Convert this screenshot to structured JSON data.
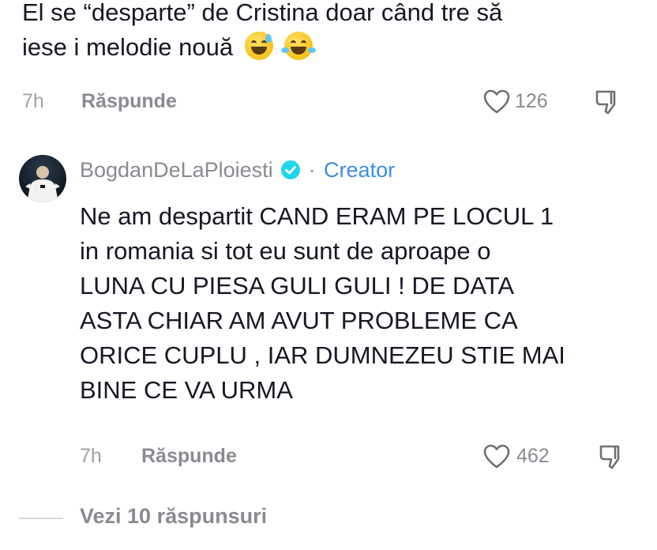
{
  "top_comment": {
    "text_line1": "El se “desparte” de Cristina doar când tre să",
    "text_line2": "iese i melodie nouă",
    "emojis": [
      "sweat-smile-emoji",
      "joy-emoji"
    ],
    "time": "7h",
    "reply_label": "Răspunde",
    "likes": "126"
  },
  "reply_comment": {
    "author": "BogdanDeLaPloiesti",
    "separator": "·",
    "role_label": "Creator",
    "lines": [
      "Ne am despartit CAND ERAM PE LOCUL 1",
      "in romania si tot eu sunt de aproape o",
      "LUNA CU PIESA GULI GULI ! DE DATA",
      "ASTA CHIAR AM AVUT PROBLEME CA",
      "ORICE CUPLU , IAR DUMNEZEU STIE MAI",
      "BINE CE VA URMA"
    ],
    "time": "7h",
    "reply_label": "Răspunde",
    "likes": "462"
  },
  "view_replies_label": "Vezi 10 răspunsuri",
  "colors": {
    "text": "#161823",
    "muted": "#8a8b91",
    "accent": "#3e8de6",
    "verified": "#20d5ec"
  }
}
